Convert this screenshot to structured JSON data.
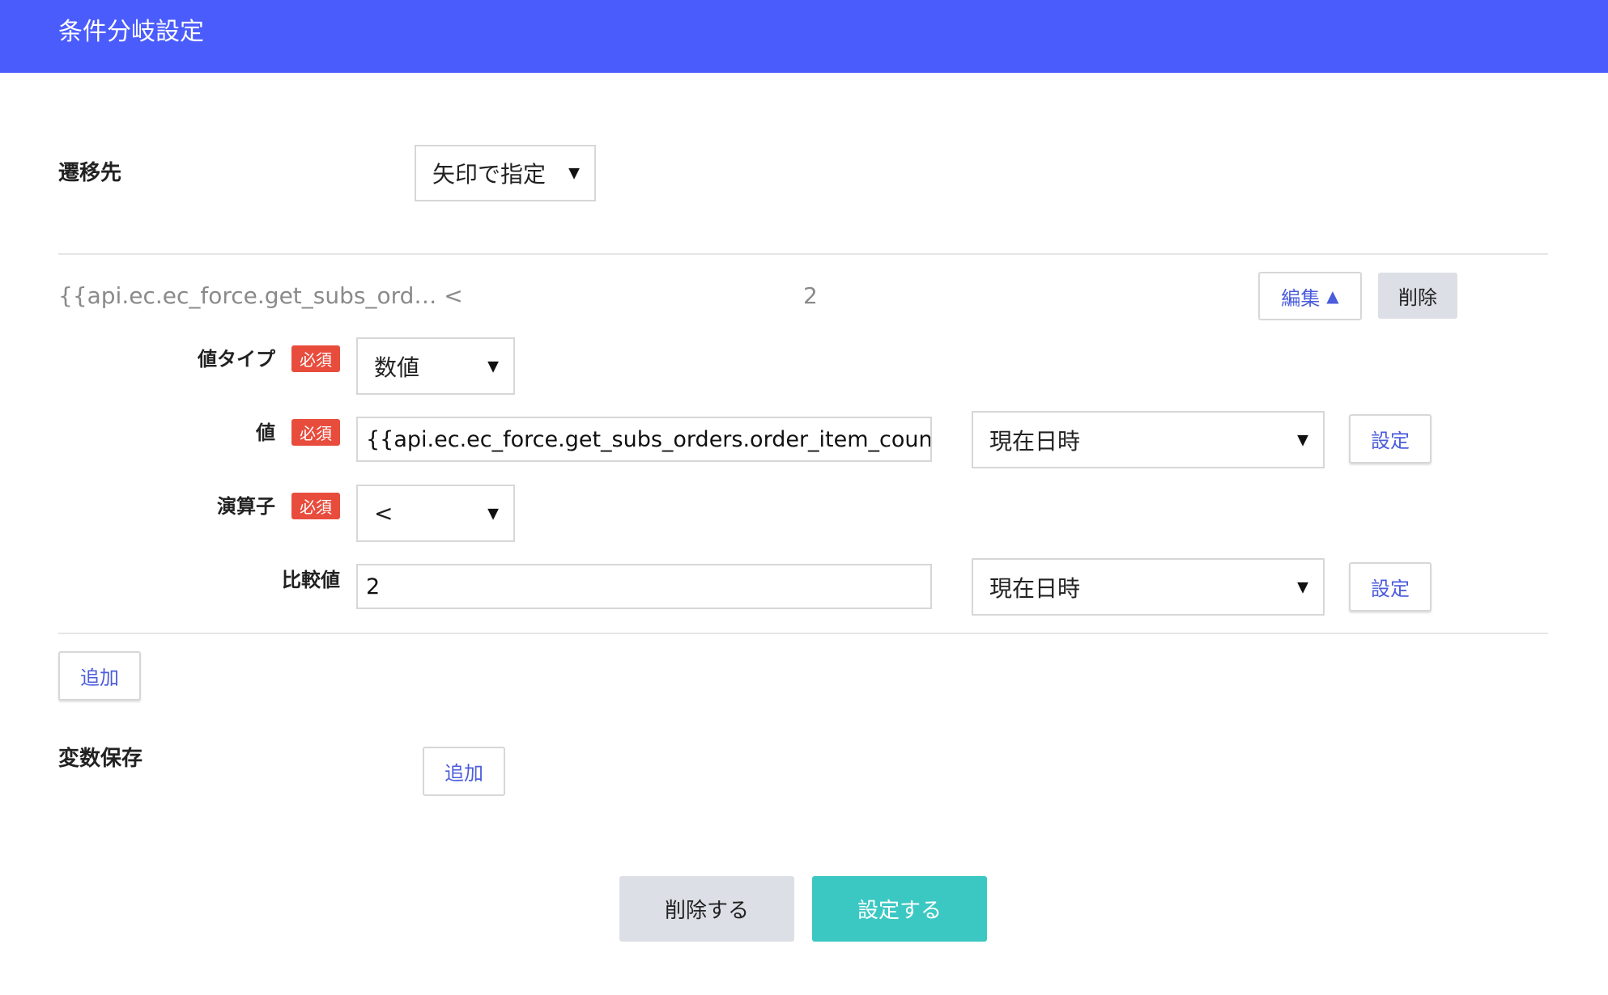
{
  "header": {
    "title": "条件分岐設定"
  },
  "destination": {
    "label": "遷移先",
    "selected": "矢印で指定",
    "arrow": "▼"
  },
  "condition": {
    "summary_left": "{{api.ec.ec_force.get_subs_ord… <",
    "summary_value": "2",
    "edit_label": "編集",
    "edit_arrow": "▲",
    "delete_label": "削除",
    "value_type": {
      "label": "値タイプ",
      "badge": "必須",
      "selected": "数値",
      "arrow": "▼"
    },
    "value": {
      "label": "値",
      "badge": "必須",
      "input_value": "{{api.ec.ec_force.get_subs_orders.order_item_count}}",
      "select": "現在日時",
      "arrow": "▼",
      "set_label": "設定"
    },
    "operator": {
      "label": "演算子",
      "badge": "必須",
      "selected": "<",
      "arrow": "▼"
    },
    "compare": {
      "label": "比較値",
      "input_value": "2",
      "select": "現在日時",
      "arrow": "▼",
      "set_label": "設定"
    }
  },
  "add_condition_label": "追加",
  "variables": {
    "label": "変数保存",
    "add_label": "追加"
  },
  "footer": {
    "delete_label": "削除する",
    "submit_label": "設定する"
  },
  "colors": {
    "header": "#4b5cfc",
    "badge": "#e84c3d",
    "submit": "#3cc8c2",
    "accent_text": "#4b5cdc"
  }
}
